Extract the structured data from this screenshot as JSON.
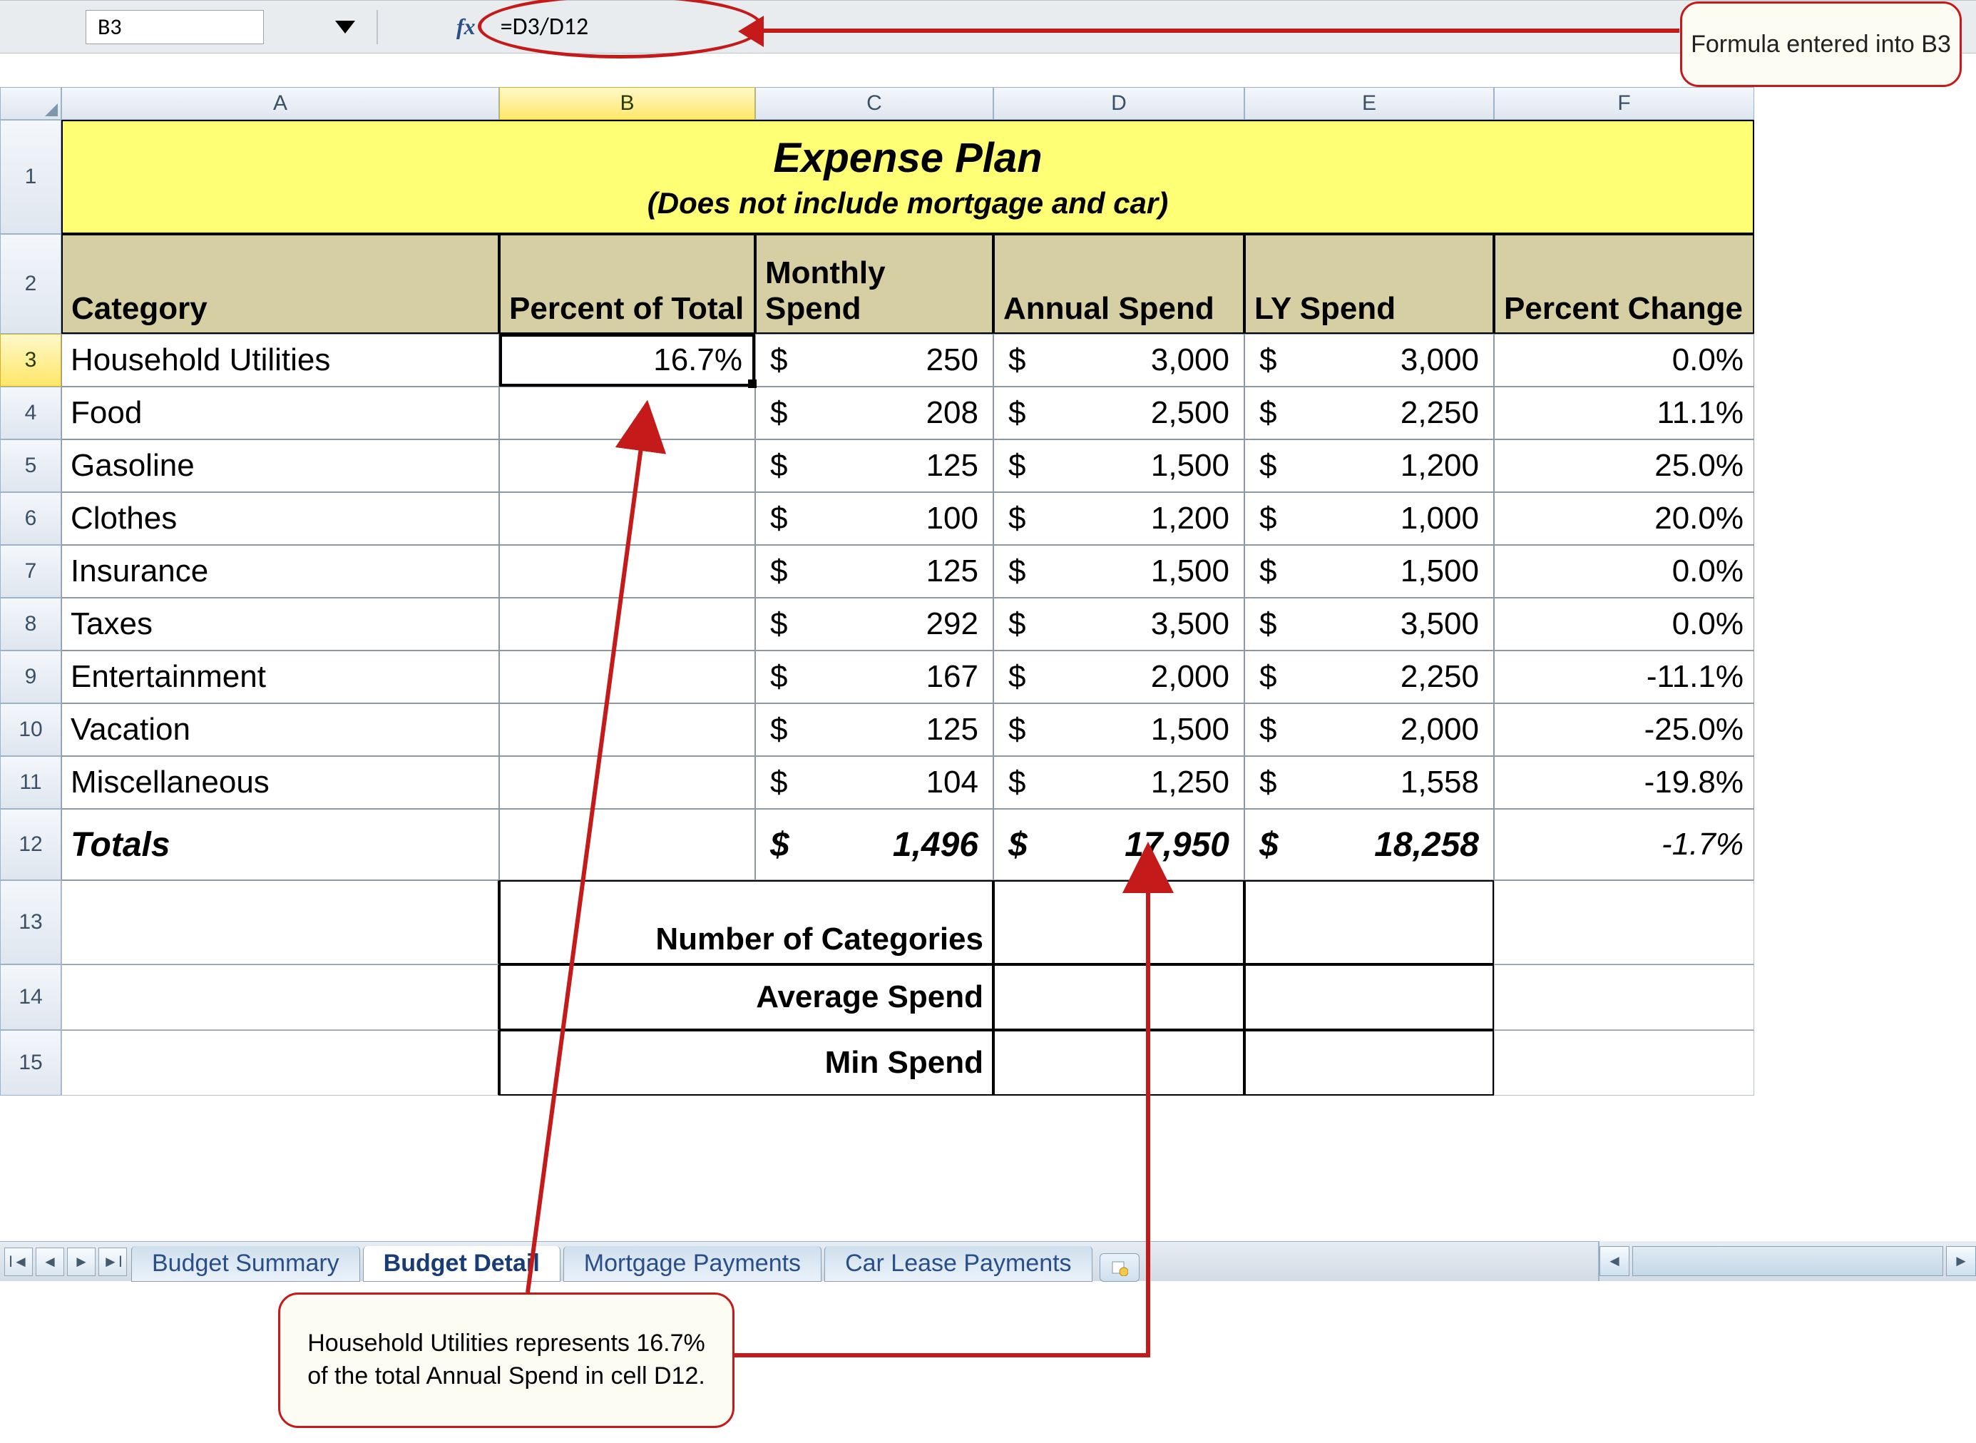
{
  "nameBox": "B3",
  "fxLabel": "fx",
  "formula": "=D3/D12",
  "calloutTop": "Formula entered into B3",
  "calloutBottom": "Household Utilities represents 16.7% of the total Annual Spend in cell D12.",
  "columns": [
    "A",
    "B",
    "C",
    "D",
    "E",
    "F"
  ],
  "rowNums": [
    "1",
    "2",
    "3",
    "4",
    "5",
    "6",
    "7",
    "8",
    "9",
    "10",
    "11",
    "12",
    "13",
    "14",
    "15"
  ],
  "title": {
    "main": "Expense Plan",
    "sub": "(Does not include mortgage and car)"
  },
  "headers": {
    "cat": "Category",
    "pct": "Percent of Total",
    "mon": "Monthly Spend",
    "ann": "Annual Spend",
    "ly": "LY Spend",
    "chg": "Percent Change"
  },
  "rows": [
    {
      "cat": "Household Utilities",
      "pct": "16.7%",
      "mon": "250",
      "ann": "3,000",
      "ly": "3,000",
      "chg": "0.0%"
    },
    {
      "cat": "Food",
      "pct": "",
      "mon": "208",
      "ann": "2,500",
      "ly": "2,250",
      "chg": "11.1%"
    },
    {
      "cat": "Gasoline",
      "pct": "",
      "mon": "125",
      "ann": "1,500",
      "ly": "1,200",
      "chg": "25.0%"
    },
    {
      "cat": "Clothes",
      "pct": "",
      "mon": "100",
      "ann": "1,200",
      "ly": "1,000",
      "chg": "20.0%"
    },
    {
      "cat": "Insurance",
      "pct": "",
      "mon": "125",
      "ann": "1,500",
      "ly": "1,500",
      "chg": "0.0%"
    },
    {
      "cat": "Taxes",
      "pct": "",
      "mon": "292",
      "ann": "3,500",
      "ly": "3,500",
      "chg": "0.0%"
    },
    {
      "cat": "Entertainment",
      "pct": "",
      "mon": "167",
      "ann": "2,000",
      "ly": "2,250",
      "chg": "-11.1%"
    },
    {
      "cat": "Vacation",
      "pct": "",
      "mon": "125",
      "ann": "1,500",
      "ly": "2,000",
      "chg": "-25.0%"
    },
    {
      "cat": "Miscellaneous",
      "pct": "",
      "mon": "104",
      "ann": "1,250",
      "ly": "1,558",
      "chg": "-19.8%"
    }
  ],
  "totals": {
    "label": "Totals",
    "mon": "1,496",
    "ann": "17,950",
    "ly": "18,258",
    "chg": "-1.7%"
  },
  "labels": {
    "numcat": "Number of Categories",
    "avg": "Average Spend",
    "min": "Min Spend"
  },
  "tabs": [
    "Budget Summary",
    "Budget Detail",
    "Mortgage Payments",
    "Car Lease Payments"
  ],
  "dollar": "$"
}
